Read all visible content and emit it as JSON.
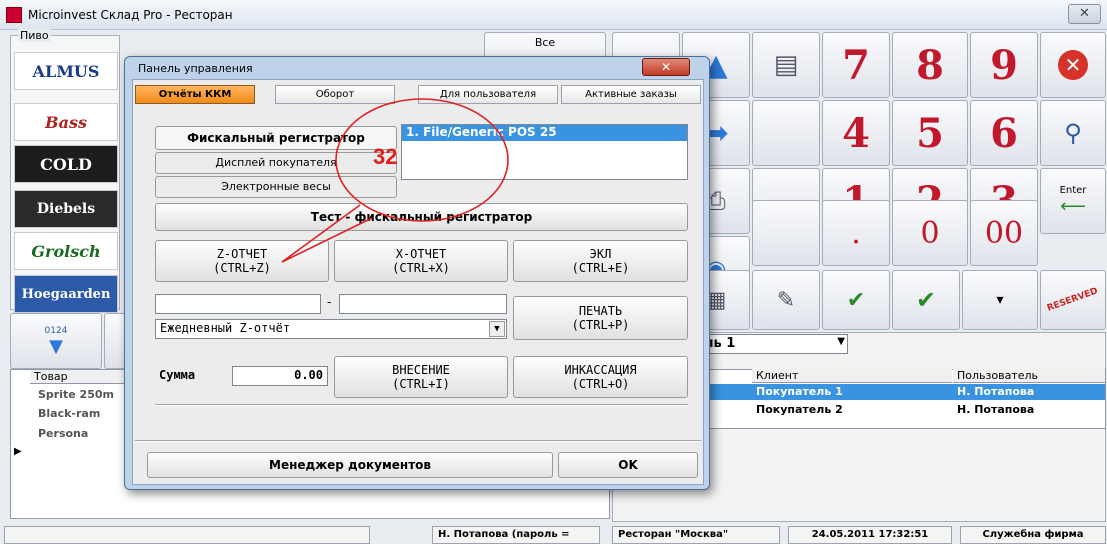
{
  "window": {
    "title": "Microinvest Склад Pro - Ресторан",
    "close": "✕"
  },
  "beer_group": {
    "label": "Пиво",
    "items": [
      "ALMUS",
      "Bass",
      "COLD",
      "Diebels",
      "Grolsch",
      "Hoegaarden"
    ]
  },
  "all_button": "Все",
  "left_nav_label": "0124",
  "keypad": {
    "digits": [
      "7",
      "8",
      "9",
      "4",
      "5",
      "6",
      "1",
      "2",
      "3",
      ".",
      "0",
      "00"
    ],
    "enter": "Enter"
  },
  "products_table": {
    "header": "Товар",
    "rows": [
      "Sprite 250m",
      "Black-ram",
      "Persona"
    ]
  },
  "orders": {
    "selector_value": "ль 1",
    "columns": [
      "Клиент",
      "Пользователь"
    ],
    "rows": [
      {
        "client": "Покупатель 1",
        "user": "Н. Потапова"
      },
      {
        "client": "Покупатель 2",
        "user": "Н. Потапова"
      }
    ]
  },
  "status": [
    "Н. Потапова  (пароль =",
    "Ресторан \"Москва\"",
    "24.05.2011 17:32:51",
    "Служебна фирма"
  ],
  "dialog": {
    "title": "Панель управления",
    "close": "✕",
    "tabs": [
      "Отчёты ККМ",
      "Оборот",
      "Для пользователя",
      "Активные заказы"
    ],
    "devices": [
      "Фискальный регистратор",
      "Дисплей покупателя",
      "Электронные весы"
    ],
    "device_list": [
      "1. File/Generic POS 25"
    ],
    "test_button": "Тест - фискальный регистратор",
    "z_report": {
      "line1": "Z-ОТЧЕТ",
      "line2": "(CTRL+Z)"
    },
    "x_report": {
      "line1": "X-ОТЧЕТ",
      "line2": "(CTRL+X)"
    },
    "ekl": {
      "line1": "ЭКЛ",
      "line2": "(CTRL+E)"
    },
    "range_sep": "-",
    "report_type": "Ежедневный Z-отчёт",
    "print": {
      "line1": "ПЕЧАТЬ",
      "line2": "(CTRL+P)"
    },
    "sum_label": "Сумма",
    "sum_value": "0.00",
    "deposit": {
      "line1": "ВНЕСЕНИЕ",
      "line2": "(CTRL+I)"
    },
    "collection": {
      "line1": "ИНКАССАЦИЯ",
      "line2": "(CTRL+O)"
    },
    "doc_manager": "Менеджер документов",
    "ok": "OK"
  },
  "annotation": {
    "number": "32",
    "color": "#e02020"
  }
}
